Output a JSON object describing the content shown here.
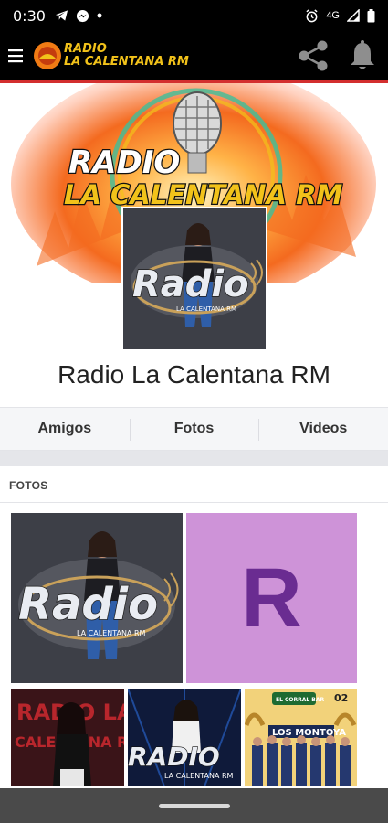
{
  "status_bar": {
    "time": "0:30",
    "network": "4G"
  },
  "app_bar": {
    "logo_line1": "RADIO",
    "logo_line2": "LA CALENTANA RM",
    "menu_icon": "hamburger-menu-icon",
    "share_icon": "share-icon",
    "bell_icon": "bell-icon"
  },
  "cover": {
    "title_line1": "RADIO",
    "title_line2": "LA CALENTANA RM"
  },
  "profile": {
    "name": "Radio La Calentana RM",
    "avatar_logo_text": "Radio",
    "avatar_sub_text": "LA CALENTANA RM"
  },
  "tabs": [
    {
      "label": "Amigos"
    },
    {
      "label": "Fotos"
    },
    {
      "label": "Videos"
    }
  ],
  "photos_section": {
    "title": "FOTOS",
    "photo1_logo": "Radio",
    "photo1_sub": "LA CALENTANA RM",
    "photo2_letter": "R",
    "photo3_text1": "RADIO LA",
    "photo3_text2": "CALENTANA RM",
    "photo4_logo": "RADIO",
    "photo4_sub": "LA CALENTANA RM",
    "photo5_title": "LOS MONTOYA",
    "photo5_number": "02",
    "photo5_badge": "EL CORRAL BAR"
  },
  "colors": {
    "accent_red": "#d32f2f",
    "logo_yellow": "#f2c21a",
    "purple_tile": "#ce93d8",
    "purple_letter": "#6a2c91"
  }
}
